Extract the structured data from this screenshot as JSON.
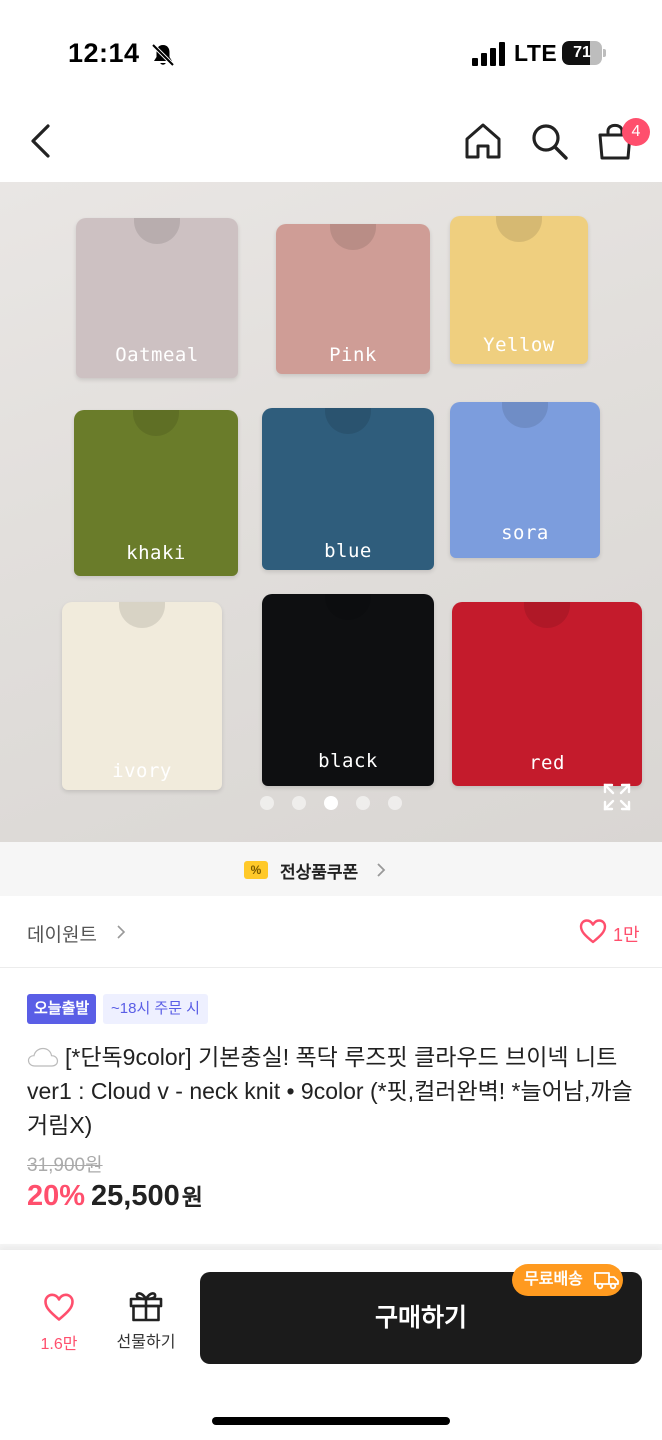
{
  "status_bar": {
    "time": "12:14",
    "network": "LTE",
    "battery": "71",
    "battery_level": 0.71
  },
  "nav": {
    "cart_count": "4",
    "icons": [
      "back-icon",
      "home-icon",
      "search-icon",
      "cart-icon"
    ]
  },
  "hero": {
    "labels": [
      "Oatmeal",
      "Pink",
      "Yellow",
      "khaki",
      "blue",
      "sora",
      "ivory",
      "black",
      "red"
    ],
    "colors": [
      "#cdc1c2",
      "#cf9d96",
      "#efcf7f",
      "#6a7c2a",
      "#2f5d7c",
      "#7c9ddd",
      "#f1ebdc",
      "#0e0f11",
      "#c41b2c"
    ],
    "slide_count": 5,
    "active_slide": 3
  },
  "coupon": {
    "label": "전상품쿠폰"
  },
  "brand": {
    "name": "데이원트",
    "likes": "1만"
  },
  "product": {
    "badge_today": "오늘출발",
    "badge_cutoff": "~18시 주문 시",
    "title": "[*단독9color] 기본충실! 폭닥 루즈핏 클라우드 브이넥 니트 ver1 : Cloud v - neck knit • 9color (*핏,컬러완벽! *늘어남,까슬거림X)",
    "original_price": "31,900원",
    "discount": "20%",
    "price": "25,500",
    "currency": "원"
  },
  "bottom_bar": {
    "like_count": "1.6만",
    "gift_label": "선물하기",
    "buy_label": "구매하기",
    "free_shipping": "무료배송"
  },
  "accent_color": "#ff4f6d"
}
